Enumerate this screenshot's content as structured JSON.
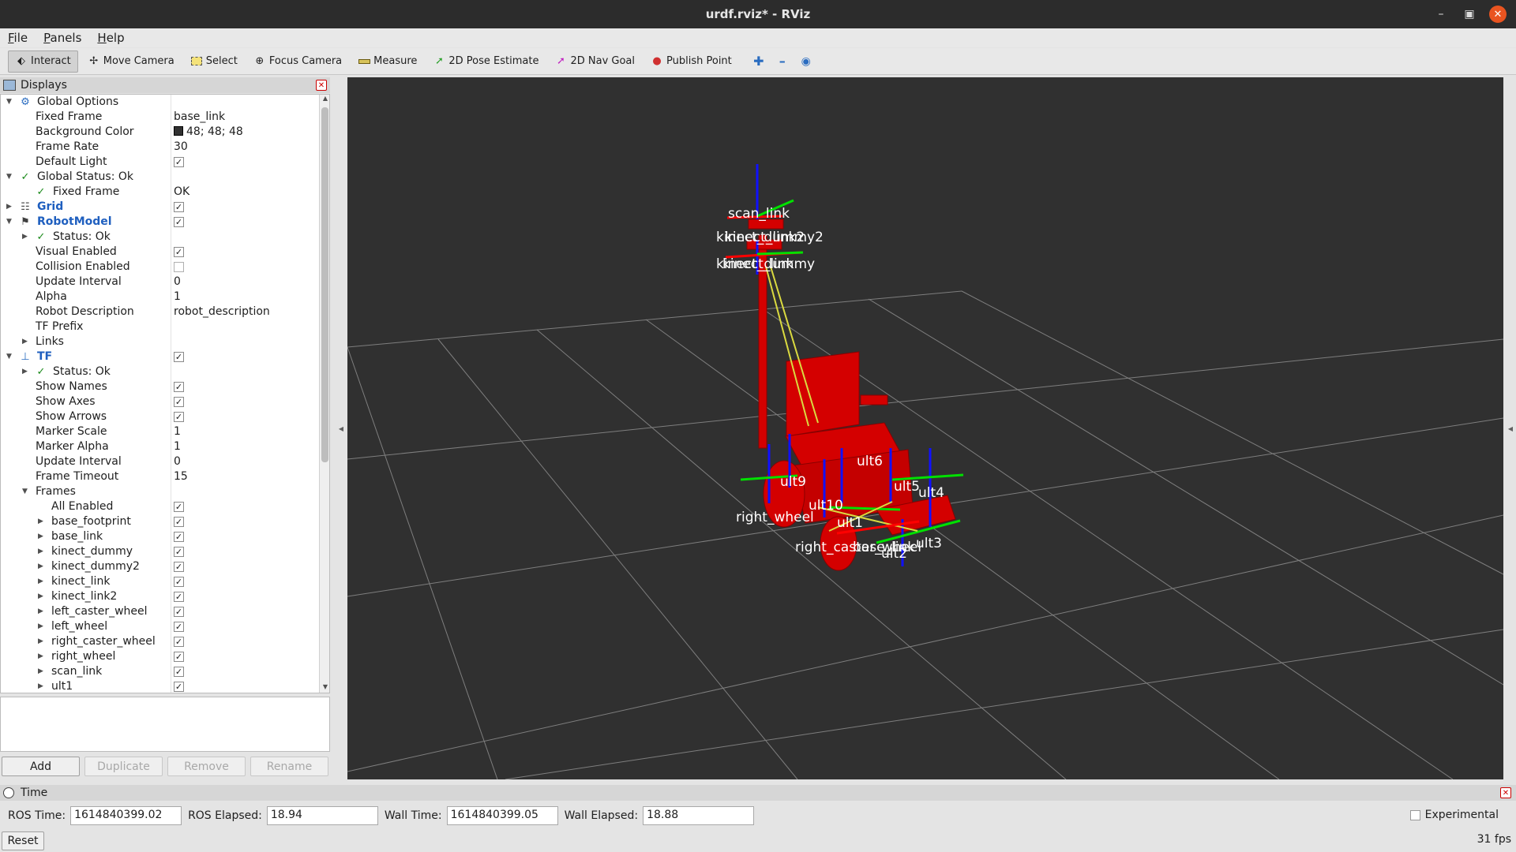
{
  "window": {
    "title": "urdf.rviz* - RViz"
  },
  "menu": [
    "File",
    "Panels",
    "Help"
  ],
  "toolbar": {
    "interact": "Interact",
    "move_camera": "Move Camera",
    "select": "Select",
    "focus_camera": "Focus Camera",
    "measure": "Measure",
    "pose_estimate": "2D Pose Estimate",
    "nav_goal": "2D Nav Goal",
    "publish_point": "Publish Point"
  },
  "displays": {
    "title": "Displays",
    "rows": [
      {
        "label": "Global Options",
        "value": ""
      },
      {
        "label": "Fixed Frame",
        "value": "base_link"
      },
      {
        "label": "Background Color",
        "value": "48; 48; 48"
      },
      {
        "label": "Frame Rate",
        "value": "30"
      },
      {
        "label": "Default Light",
        "value": ""
      },
      {
        "label": "Global Status: Ok",
        "value": ""
      },
      {
        "label": "Fixed Frame",
        "value": "OK"
      },
      {
        "label": "Grid",
        "value": ""
      },
      {
        "label": "RobotModel",
        "value": ""
      },
      {
        "label": "Status: Ok",
        "value": ""
      },
      {
        "label": "Visual Enabled",
        "value": ""
      },
      {
        "label": "Collision Enabled",
        "value": ""
      },
      {
        "label": "Update Interval",
        "value": "0"
      },
      {
        "label": "Alpha",
        "value": "1"
      },
      {
        "label": "Robot Description",
        "value": "robot_description"
      },
      {
        "label": "TF Prefix",
        "value": ""
      },
      {
        "label": "Links",
        "value": ""
      },
      {
        "label": "TF",
        "value": ""
      },
      {
        "label": "Status: Ok",
        "value": ""
      },
      {
        "label": "Show Names",
        "value": ""
      },
      {
        "label": "Show Axes",
        "value": ""
      },
      {
        "label": "Show Arrows",
        "value": ""
      },
      {
        "label": "Marker Scale",
        "value": "1"
      },
      {
        "label": "Marker Alpha",
        "value": "1"
      },
      {
        "label": "Update Interval",
        "value": "0"
      },
      {
        "label": "Frame Timeout",
        "value": "15"
      },
      {
        "label": "Frames",
        "value": ""
      },
      {
        "label": "All Enabled",
        "value": ""
      },
      {
        "label": "base_footprint",
        "value": ""
      },
      {
        "label": "base_link",
        "value": ""
      },
      {
        "label": "kinect_dummy",
        "value": ""
      },
      {
        "label": "kinect_dummy2",
        "value": ""
      },
      {
        "label": "kinect_link",
        "value": ""
      },
      {
        "label": "kinect_link2",
        "value": ""
      },
      {
        "label": "left_caster_wheel",
        "value": ""
      },
      {
        "label": "left_wheel",
        "value": ""
      },
      {
        "label": "right_caster_wheel",
        "value": ""
      },
      {
        "label": "right_wheel",
        "value": ""
      },
      {
        "label": "scan_link",
        "value": ""
      },
      {
        "label": "ult1",
        "value": ""
      }
    ],
    "buttons": {
      "add": "Add",
      "duplicate": "Duplicate",
      "remove": "Remove",
      "rename": "Rename"
    }
  },
  "scene": {
    "labels": {
      "scan_link": "scan_link",
      "kinect_top": "kinect_dummy2",
      "kinect_top_ghost": "kinect_link2",
      "kinect_bottom": "kinect_dummy",
      "kinect_bottom_ghost": "kinect_link",
      "ult6": "ult6",
      "ult5": "ult5",
      "ult4": "ult4",
      "ult9": "ult9",
      "ult10": "ult10",
      "right_wheel": "right_wheel",
      "ult1": "ult1",
      "ult3": "ult3",
      "ult2": "ult2",
      "right_caster": "right_caster_wheel",
      "base_link": "base_link"
    },
    "colors": {
      "background": "#303030",
      "robot": "#d40000",
      "grid": "#a0a0a0"
    }
  },
  "time": {
    "title": "Time",
    "ros_time_label": "ROS Time:",
    "ros_time": "1614840399.02",
    "ros_elapsed_label": "ROS Elapsed:",
    "ros_elapsed": "18.94",
    "wall_time_label": "Wall Time:",
    "wall_time": "1614840399.05",
    "wall_elapsed_label": "Wall Elapsed:",
    "wall_elapsed": "18.88",
    "experimental": "Experimental",
    "reset": "Reset",
    "fps": "31 fps"
  }
}
